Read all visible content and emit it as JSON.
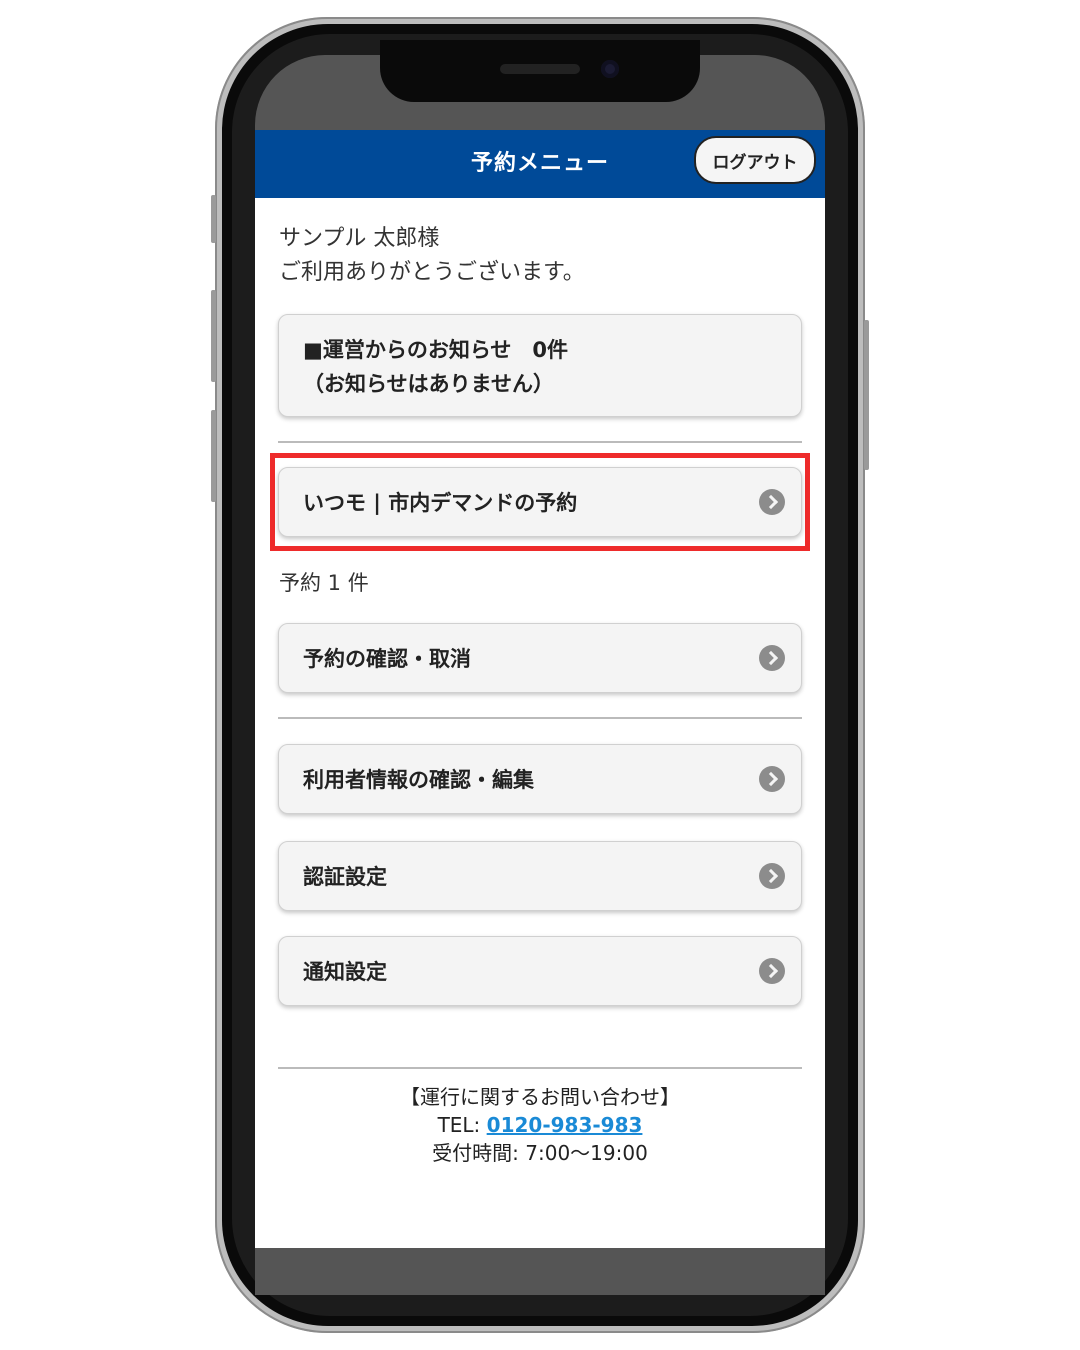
{
  "header": {
    "title": "予約メニュー",
    "logout_label": "ログアウト"
  },
  "greeting": {
    "name": "サンプル 太郎様",
    "message": "ご利用ありがとうございます。"
  },
  "notice": {
    "line1": "■運営からのお知らせ　0件",
    "line2": "（お知らせはありません）"
  },
  "reserve_button": {
    "label": "いつモ | 市内デマンドの予約"
  },
  "reservation_count": "予約 1 件",
  "menu": {
    "confirm_cancel": "予約の確認・取消",
    "user_info": "利用者情報の確認・編集",
    "auth_settings": "認証設定",
    "notify_settings": "通知設定"
  },
  "footer": {
    "inquiry_title": "【運行に関するお問い合わせ】",
    "tel_prefix": "TEL: ",
    "tel_number": "0120-983-983",
    "hours": "受付時間: 7:00〜19:00"
  },
  "colors": {
    "header_bg": "#004a98",
    "highlight_border": "#ee2b2b",
    "link": "#1a8ad6"
  }
}
